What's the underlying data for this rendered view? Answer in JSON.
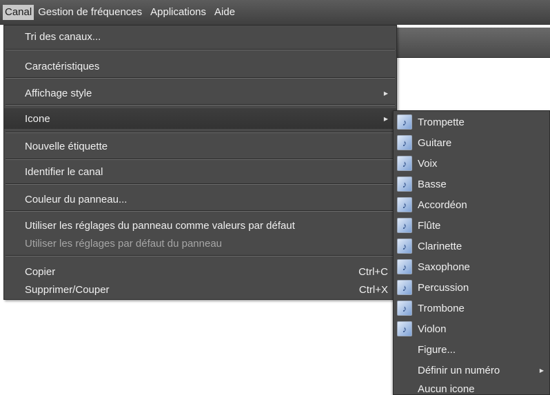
{
  "menubar": {
    "items": [
      "Canal",
      "Gestion de fréquences",
      "Applications",
      "Aide"
    ],
    "active": "Canal"
  },
  "menu": {
    "items": [
      {
        "label": "Tri des canaux..."
      },
      {
        "label": "Caractéristiques"
      },
      {
        "label": "Affichage style",
        "submenu": true
      },
      {
        "label": "Icone",
        "submenu": true,
        "highlighted": true
      },
      {
        "label": "Nouvelle étiquette"
      },
      {
        "label": "Identifier le canal"
      },
      {
        "label": "Couleur du panneau..."
      },
      {
        "label": "Utiliser les réglages du panneau comme valeurs par défaut"
      },
      {
        "label": "Utiliser les réglages par défaut du panneau",
        "disabled": true
      },
      {
        "label": "Copier",
        "shortcut": "Ctrl+C"
      },
      {
        "label": "Supprimer/Couper",
        "shortcut": "Ctrl+X"
      }
    ]
  },
  "submenu": {
    "items": [
      {
        "label": "Trompette",
        "icon": "trumpet-icon"
      },
      {
        "label": "Guitare",
        "icon": "guitar-icon"
      },
      {
        "label": "Voix",
        "icon": "microphone-icon"
      },
      {
        "label": "Basse",
        "icon": "bass-guitar-icon"
      },
      {
        "label": "Accordéon",
        "icon": "accordion-icon"
      },
      {
        "label": "Flûte",
        "icon": "flute-icon"
      },
      {
        "label": "Clarinette",
        "icon": "clarinet-icon"
      },
      {
        "label": "Saxophone",
        "icon": "saxophone-icon"
      },
      {
        "label": "Percussion",
        "icon": "drum-icon"
      },
      {
        "label": "Trombone",
        "icon": "trombone-icon"
      },
      {
        "label": "Violon",
        "icon": "violin-icon"
      },
      {
        "label": "Figure..."
      },
      {
        "label": "Définir un numéro",
        "submenu": true
      },
      {
        "label": "Aucun icone"
      }
    ]
  },
  "colors": {
    "menu_bg": "#4a4a4a",
    "highlight_bg": "#363636",
    "text": "#f0f0f0",
    "disabled_text": "#a6a6a6"
  }
}
